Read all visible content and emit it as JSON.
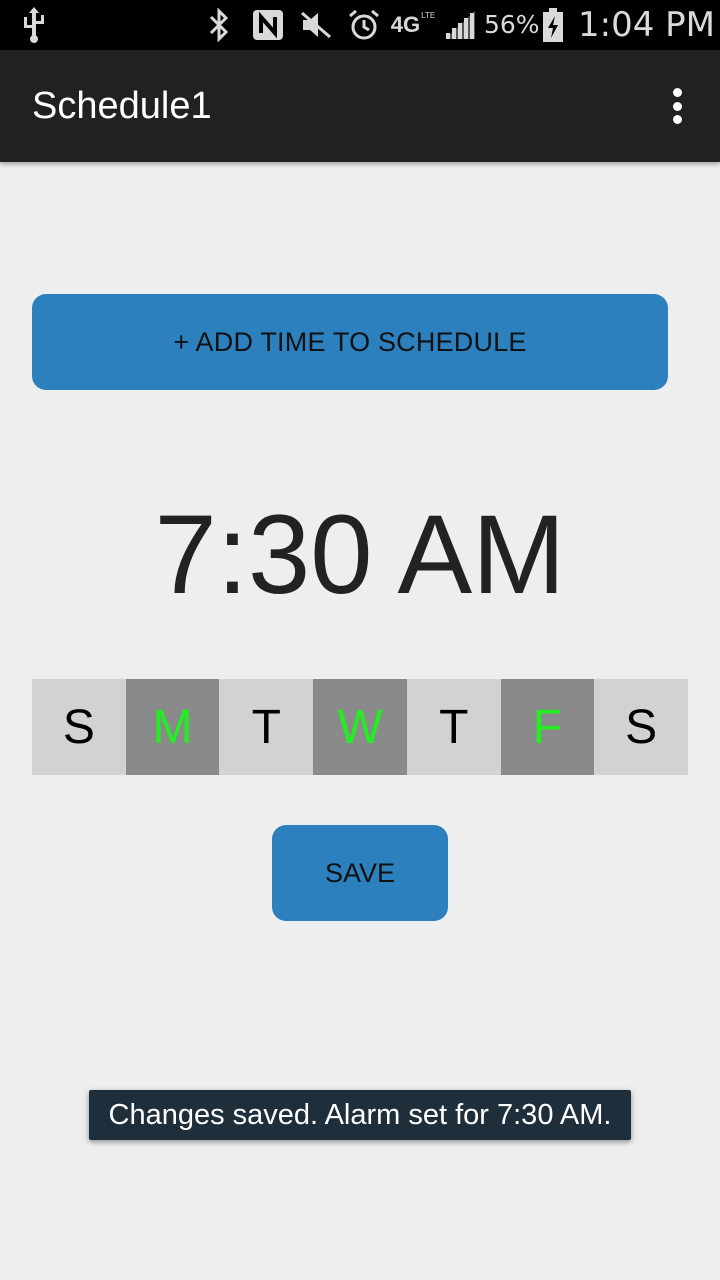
{
  "status_bar": {
    "icons": [
      "usb-icon",
      "bluetooth-icon",
      "nfc-icon",
      "mute-icon",
      "alarm-icon",
      "4g-lte-icon",
      "signal-icon",
      "battery-charging-icon"
    ],
    "network_label": "4G",
    "network_sub": "LTE",
    "battery_percent": "56%",
    "time": "1:04 PM"
  },
  "app_bar": {
    "title": "Schedule1",
    "overflow_icon": "more-vert-icon"
  },
  "add_button": {
    "label": "+ ADD TIME TO SCHEDULE"
  },
  "time_display": "7:30 AM",
  "days": [
    {
      "label": "S",
      "selected": false
    },
    {
      "label": "M",
      "selected": true
    },
    {
      "label": "T",
      "selected": false
    },
    {
      "label": "W",
      "selected": true
    },
    {
      "label": "T",
      "selected": false
    },
    {
      "label": "F",
      "selected": true
    },
    {
      "label": "S",
      "selected": false
    }
  ],
  "save_button": {
    "label": "SAVE"
  },
  "toast": {
    "message": "Changes saved. Alarm set for 7:30 AM."
  },
  "colors": {
    "primary_button": "#2b80bd",
    "app_bar": "#212121",
    "day_selected_bg": "#8a8a8a",
    "day_selected_text": "#22ee22",
    "day_unselected_bg": "#d2d2d2"
  }
}
